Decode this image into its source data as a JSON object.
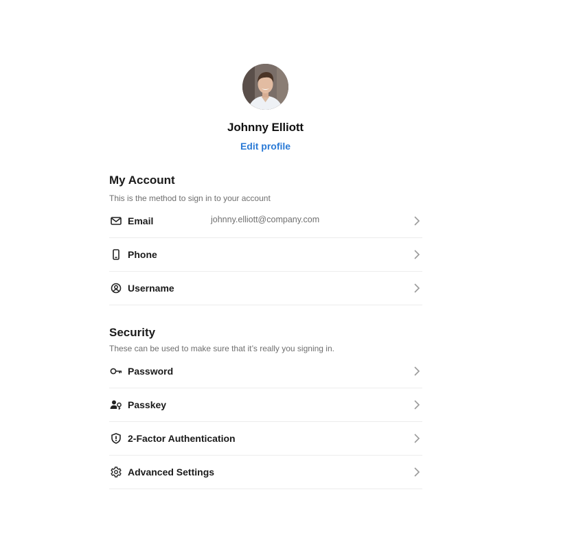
{
  "profile": {
    "name": "Johnny Elliott",
    "edit_label": "Edit profile"
  },
  "account": {
    "title": "My Account",
    "description": "This is the method to sign in to your account",
    "items": [
      {
        "label": "Email",
        "value": "johnny.elliott@company.com",
        "icon": "mail-icon"
      },
      {
        "label": "Phone",
        "value": "",
        "icon": "phone-icon"
      },
      {
        "label": "Username",
        "value": "",
        "icon": "user-circle-icon"
      }
    ]
  },
  "security": {
    "title": "Security",
    "description": "These can be used to make sure that it’s really you signing in.",
    "items": [
      {
        "label": "Password",
        "icon": "key-icon"
      },
      {
        "label": "Passkey",
        "icon": "user-key-icon"
      },
      {
        "label": "2-Factor Authentication",
        "icon": "shield-icon"
      },
      {
        "label": "Advanced Settings",
        "icon": "gear-icon"
      }
    ]
  },
  "colors": {
    "accent": "#2a7ad6",
    "text": "#1a1a1a",
    "muted": "#6e6e6e",
    "divider": "#ececec"
  }
}
